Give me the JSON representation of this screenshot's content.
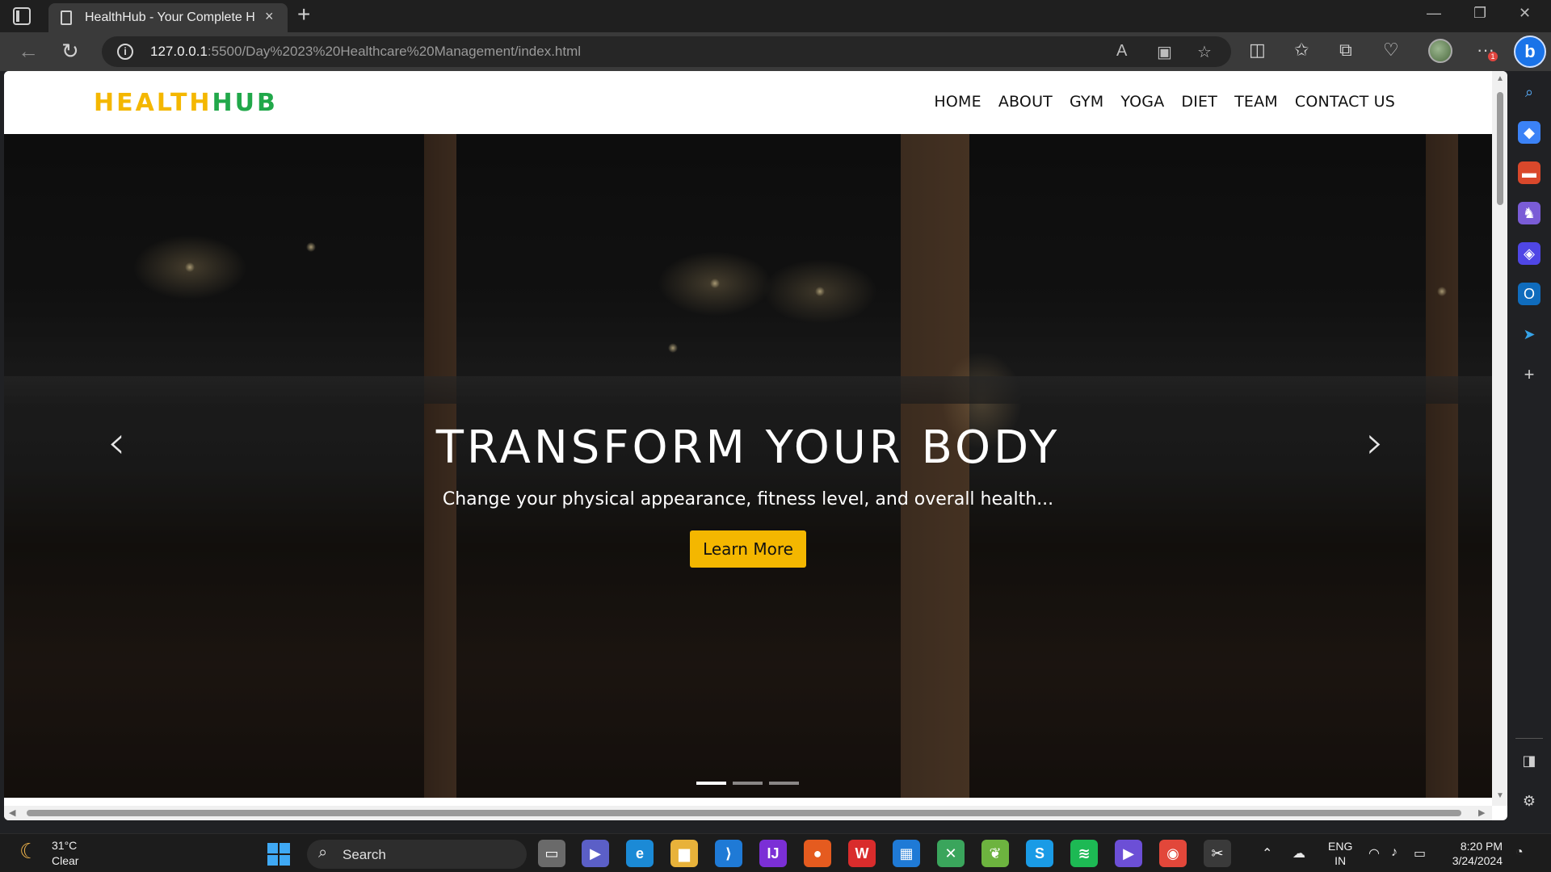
{
  "browser": {
    "tab_title": "HealthHub - Your Complete Heal",
    "new_tab": "+",
    "close_tab": "×",
    "url_host": "127.0.0.1",
    "url_rest": ":5500/Day%2023%20Healthcare%20Management/index.html",
    "more_badge": "1"
  },
  "site": {
    "logo_part1": "HEALTH",
    "logo_part2": "HUB",
    "nav": [
      "HOME",
      "ABOUT",
      "GYM",
      "YOGA",
      "DIET",
      "TEAM",
      "CONTACT US"
    ]
  },
  "hero": {
    "title": "TRANSFORM YOUR BODY",
    "subtitle": "Change your physical appearance, fitness level, and overall health...",
    "button": "Learn More",
    "slides": 3,
    "active_slide": 1
  },
  "taskbar": {
    "weather_temp": "31°C",
    "weather_condition": "Clear",
    "search_label": "Search",
    "lang_1": "ENG",
    "lang_2": "IN",
    "time": "8:20 PM",
    "date": "3/24/2024"
  },
  "colors": {
    "logo_yellow": "#f4b700",
    "logo_green": "#21a84a",
    "button_yellow": "#f4b700"
  },
  "icons": {
    "sidebar": [
      "search-icon",
      "tag-icon",
      "toolbox-icon",
      "games-icon",
      "copilot-icon",
      "outlook-icon",
      "telegram-icon",
      "add-icon"
    ],
    "taskbar_apps": [
      "file-explorer-icon",
      "teams-icon",
      "edge-icon",
      "folder-icon",
      "vscode-icon",
      "intellij-icon",
      "firefox-icon",
      "wps-icon",
      "store-icon",
      "xcode-icon",
      "spring-icon",
      "skype-icon",
      "spotify-icon",
      "copilot-icon",
      "chrome-icon",
      "snipping-icon"
    ]
  }
}
